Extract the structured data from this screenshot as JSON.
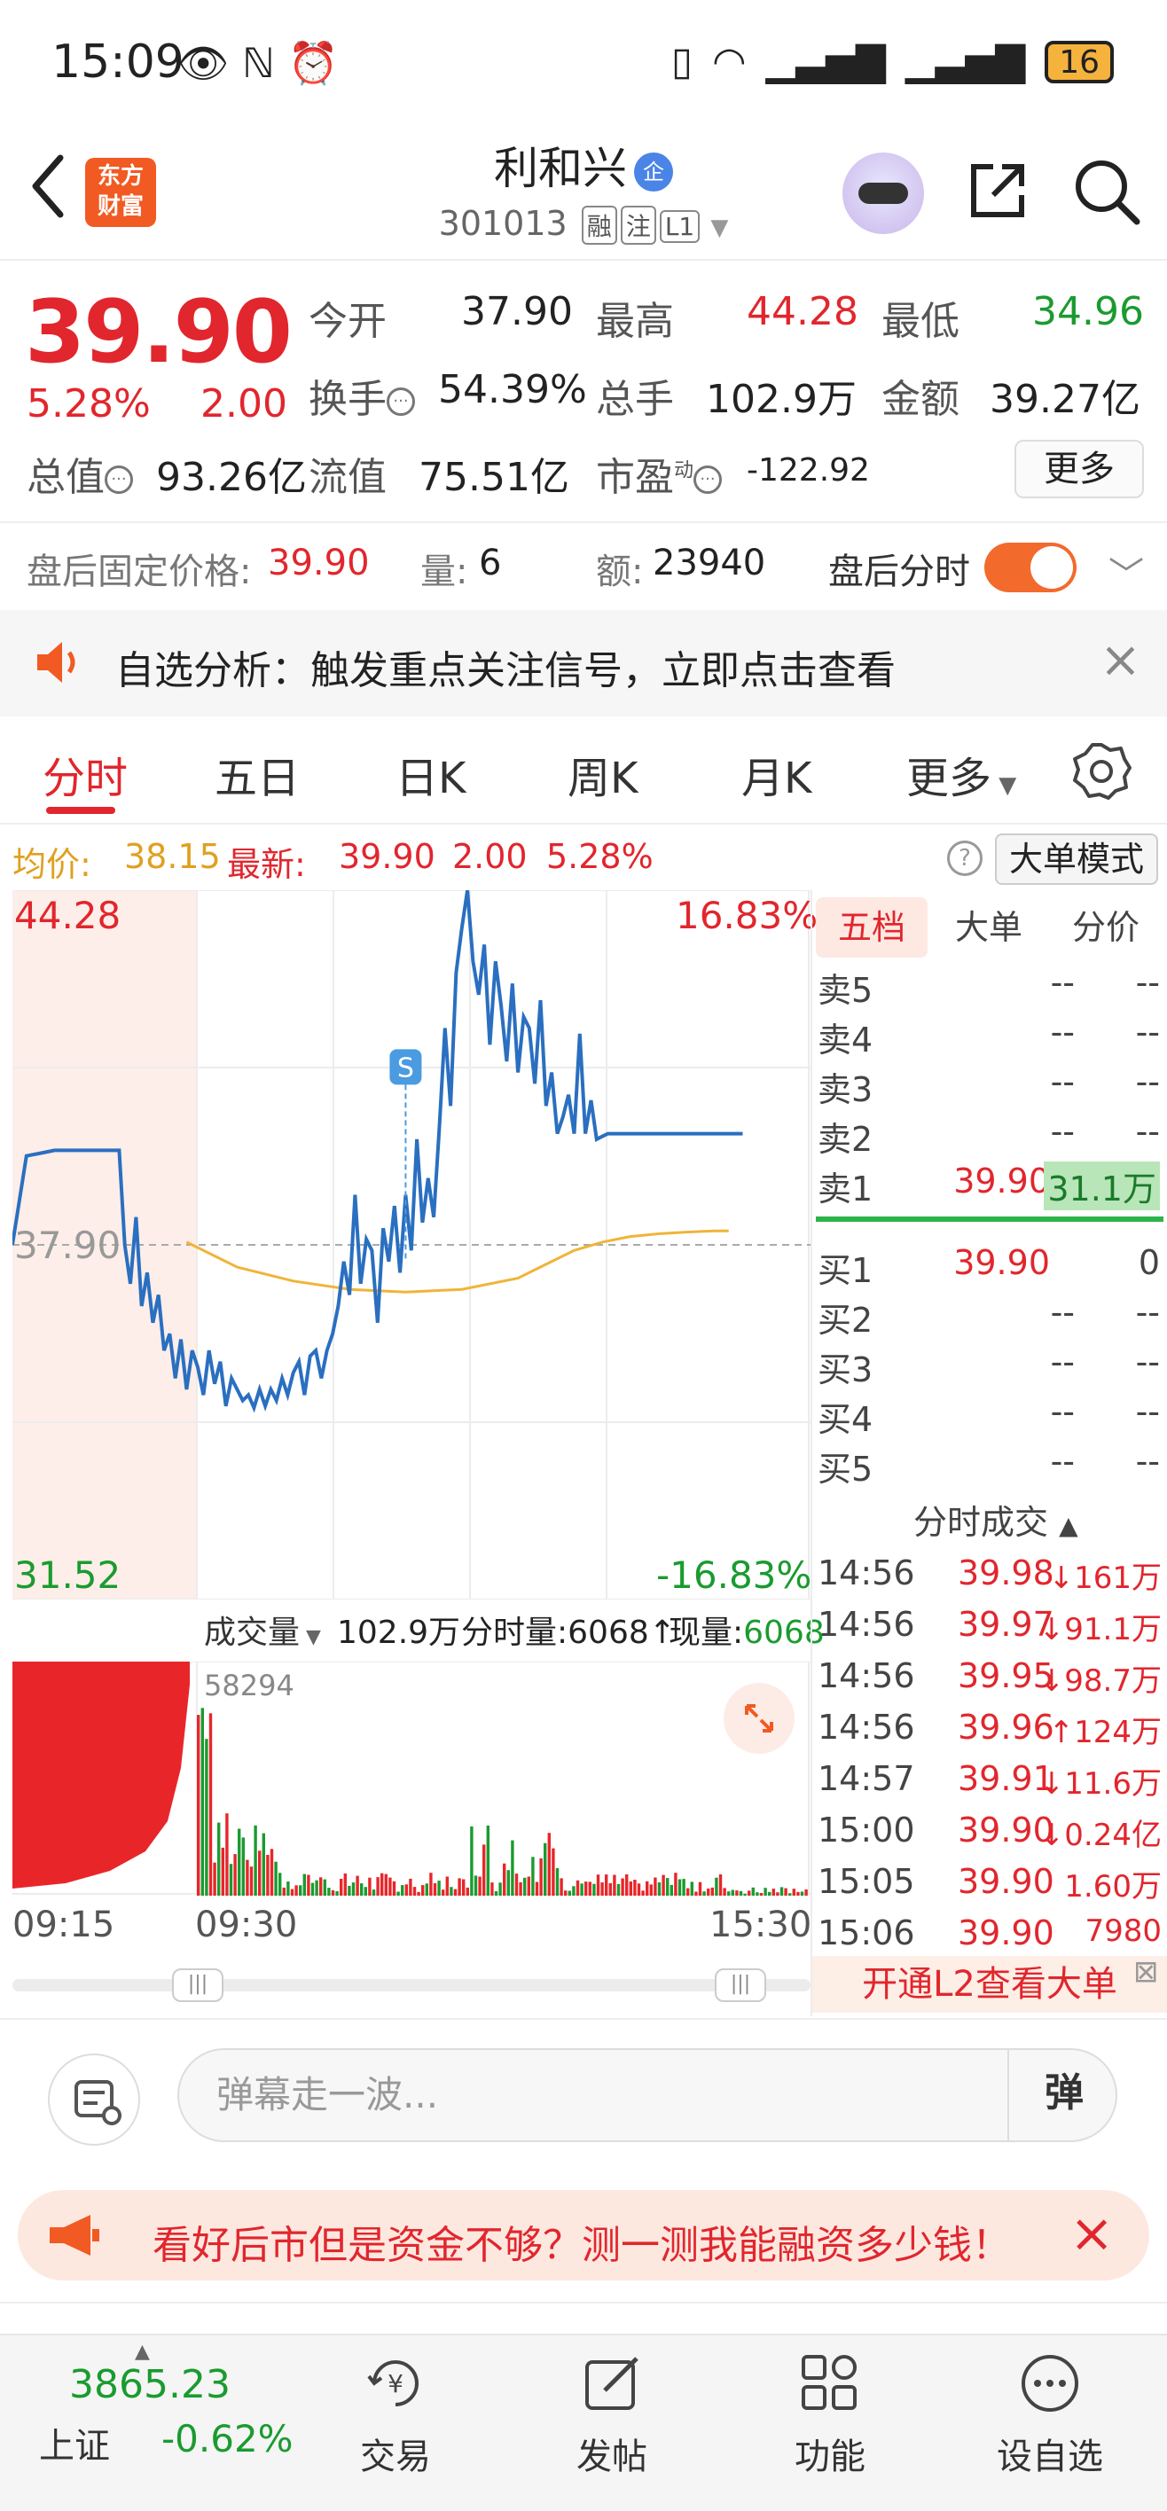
{
  "status_bar": {
    "time": "15:09",
    "battery": "16"
  },
  "header": {
    "logo_text": "东方财富",
    "stock_name": "利和兴",
    "enterprise_badge": "企",
    "stock_code": "301013",
    "tags": [
      "融",
      "注",
      "L1"
    ]
  },
  "quote": {
    "price": "39.90",
    "change_pct": "5.28%",
    "change": "2.00",
    "open_label": "今开",
    "open": "37.90",
    "high_label": "最高",
    "high": "44.28",
    "low_label": "最低",
    "low": "34.96",
    "turnover_label": "换手",
    "turnover": "54.39%",
    "volume_label": "总手",
    "volume": "102.9万",
    "amount_label": "金额",
    "amount": "39.27亿",
    "mktcap_label": "总值",
    "mktcap": "93.26亿",
    "float_label": "流值",
    "float": "75.51亿",
    "pe_label": "市盈",
    "pe_sup": "动",
    "pe": "-122.92",
    "more_label": "更多"
  },
  "after_hours": {
    "price_label": "盘后固定价格:",
    "price": "39.90",
    "qty_label": "量:",
    "qty": "6",
    "amt_label": "额:",
    "amt": "23940",
    "toggle_label": "盘后分时"
  },
  "notice": {
    "text": "自选分析：触发重点关注信号，立即点击查看"
  },
  "tabs": [
    "分时",
    "五日",
    "日K",
    "周K",
    "月K",
    "更多"
  ],
  "summary_row": {
    "avg_label": "均价:",
    "avg": "38.15",
    "latest_label": "最新:",
    "latest": "39.90",
    "change": "2.00",
    "change_pct": "5.28%",
    "big_order_mode": "大单模式"
  },
  "chart_data": {
    "type": "line",
    "title": "",
    "y_top": "44.28",
    "y_mid": "37.90",
    "y_bottom": "31.52",
    "pct_top": "16.83%",
    "pct_bottom": "-16.83%",
    "ylim": [
      31.52,
      44.28
    ],
    "prev_close": 37.9,
    "marker": "S",
    "x": [
      0,
      5,
      10,
      15,
      20,
      25,
      28,
      30,
      32,
      34,
      36,
      38,
      40,
      42,
      44,
      46,
      48,
      50,
      52,
      54,
      56,
      58,
      60,
      62,
      64,
      66,
      68,
      70,
      72,
      74,
      76,
      78,
      80,
      82,
      84,
      86,
      88,
      90,
      92,
      94,
      96,
      98,
      100,
      102,
      104,
      106,
      108,
      110,
      112,
      114,
      116,
      118,
      120,
      122,
      124,
      126,
      128,
      130,
      132,
      134,
      136,
      138,
      140,
      142,
      144,
      146,
      148,
      150,
      152,
      154,
      156,
      158,
      160,
      162,
      164,
      166,
      168,
      170,
      172,
      174,
      176,
      178,
      180,
      182,
      184,
      186,
      188,
      190,
      192,
      194,
      196,
      198,
      200,
      202,
      204,
      206,
      208,
      210,
      212,
      214,
      216,
      218,
      220,
      222,
      224,
      226,
      228,
      230,
      232,
      234,
      236,
      238,
      240,
      242,
      244,
      246,
      248,
      250,
      252,
      255,
      260
    ],
    "price": [
      37.9,
      39.5,
      39.55,
      39.6,
      39.6,
      39.6,
      39.6,
      39.6,
      39.6,
      39.6,
      39.6,
      39.6,
      37.9,
      37.2,
      38.4,
      36.8,
      37.4,
      36.5,
      37.0,
      36.0,
      36.3,
      35.5,
      36.2,
      35.3,
      36.0,
      35.7,
      35.2,
      36.0,
      35.4,
      35.8,
      35.0,
      35.5,
      35.3,
      35.1,
      35.2,
      34.97,
      35.3,
      35.0,
      35.3,
      35.1,
      35.5,
      35.2,
      35.6,
      35.8,
      35.2,
      35.9,
      36.0,
      35.5,
      36.0,
      36.3,
      36.8,
      37.6,
      37.0,
      38.8,
      37.2,
      38.0,
      37.8,
      36.5,
      38.2,
      37.6,
      38.6,
      37.4,
      38.8,
      37.8,
      39.8,
      38.3,
      39.1,
      38.4,
      40.0,
      41.8,
      40.4,
      42.8,
      43.6,
      44.28,
      43.0,
      42.4,
      43.3,
      41.5,
      43.0,
      42.2,
      41.2,
      42.6,
      41.0,
      42.0,
      41.8,
      40.8,
      42.3,
      40.4,
      41.0,
      39.9,
      40.2,
      40.6,
      39.9,
      41.7,
      39.9,
      40.5,
      39.8,
      39.85,
      39.9,
      39.9,
      39.9,
      39.9,
      39.9,
      39.9,
      39.9,
      39.9,
      39.9,
      39.9,
      39.9,
      39.9,
      39.9,
      39.9,
      39.9,
      39.9,
      39.9,
      39.9,
      39.9,
      39.9,
      39.9,
      39.9,
      39.9
    ],
    "avg_x": [
      62,
      80,
      100,
      120,
      140,
      160,
      180,
      190,
      200,
      210,
      220,
      230,
      240,
      250,
      255
    ],
    "avg": [
      37.95,
      37.5,
      37.25,
      37.1,
      37.05,
      37.1,
      37.3,
      37.55,
      37.8,
      37.95,
      38.05,
      38.1,
      38.13,
      38.15,
      38.15
    ]
  },
  "volume": {
    "label": "成交量",
    "total": "102.9万",
    "minute_vol_label": "分时量:",
    "minute_vol": "6068",
    "current_vol_label": "现量:",
    "current_vol": "6068",
    "peak": "58294",
    "time_start": "09:15",
    "time_open": "09:30",
    "time_end": "15:30"
  },
  "order_book": {
    "tabs": [
      "五档",
      "大单",
      "分价"
    ],
    "asks": [
      {
        "label": "卖5",
        "price": "--",
        "vol": "--"
      },
      {
        "label": "卖4",
        "price": "--",
        "vol": "--"
      },
      {
        "label": "卖3",
        "price": "--",
        "vol": "--"
      },
      {
        "label": "卖2",
        "price": "--",
        "vol": "--"
      },
      {
        "label": "卖1",
        "price": "39.90",
        "vol": "31.1万"
      }
    ],
    "bids": [
      {
        "label": "买1",
        "price": "39.90",
        "vol": "0"
      },
      {
        "label": "买2",
        "price": "--",
        "vol": "--"
      },
      {
        "label": "买3",
        "price": "--",
        "vol": "--"
      },
      {
        "label": "买4",
        "price": "--",
        "vol": "--"
      },
      {
        "label": "买5",
        "price": "--",
        "vol": "--"
      }
    ]
  },
  "ticks": {
    "title": "分时成交",
    "rows": [
      {
        "time": "14:56",
        "price": "39.98",
        "vol": "↓161万"
      },
      {
        "time": "14:56",
        "price": "39.97",
        "vol": "↓91.1万"
      },
      {
        "time": "14:56",
        "price": "39.95",
        "vol": "↓98.7万"
      },
      {
        "time": "14:56",
        "price": "39.96",
        "vol": "↑124万"
      },
      {
        "time": "14:57",
        "price": "39.91",
        "vol": "↓11.6万"
      },
      {
        "time": "15:00",
        "price": "39.90",
        "vol": "↓0.24亿"
      },
      {
        "time": "15:05",
        "price": "39.90",
        "vol": "1.60万"
      },
      {
        "time": "15:06",
        "price": "39.90",
        "vol": "7980"
      }
    ],
    "l2_banner": "开通L2查看大单"
  },
  "danmu": {
    "placeholder": "弹幕走一波...",
    "send": "弹"
  },
  "promo": {
    "text": "看好后市但是资金不够？测一测我能融资多少钱！"
  },
  "bottom_nav": {
    "index_value": "3865.23",
    "index_name": "上证",
    "index_change": "-0.62%",
    "items": [
      "交易",
      "发帖",
      "功能",
      "设自选"
    ]
  }
}
